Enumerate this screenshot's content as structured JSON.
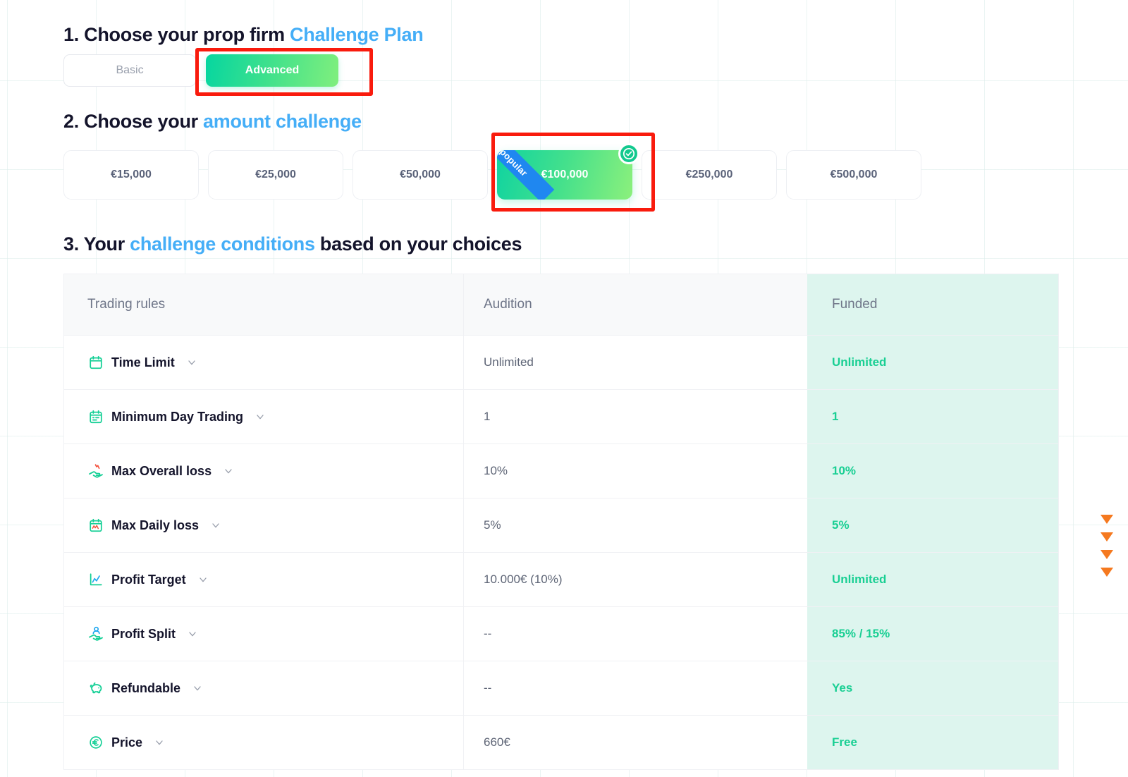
{
  "steps": {
    "step1": {
      "prefix": "1. Choose your prop firm ",
      "accent": "Challenge Plan"
    },
    "step2": {
      "prefix": "2. Choose your ",
      "accent": "amount challenge"
    },
    "step3": {
      "prefix": "3. Your ",
      "accent": "challenge conditions",
      "suffix": " based on your choices"
    }
  },
  "plan_toggle": {
    "basic_label": "Basic",
    "advanced_label": "Advanced",
    "selected": "Advanced"
  },
  "amounts": {
    "options": [
      {
        "label": "€15,000",
        "selected": false,
        "ribbon": ""
      },
      {
        "label": "€25,000",
        "selected": false,
        "ribbon": ""
      },
      {
        "label": "€50,000",
        "selected": false,
        "ribbon": ""
      },
      {
        "label": "€100,000",
        "selected": true,
        "ribbon": "popular"
      },
      {
        "label": "€250,000",
        "selected": false,
        "ribbon": ""
      },
      {
        "label": "€500,000",
        "selected": false,
        "ribbon": ""
      }
    ],
    "selected_label": "€100,000",
    "ribbon_label": "popular"
  },
  "table": {
    "headers": {
      "rules": "Trading rules",
      "audition": "Audition",
      "funded": "Funded"
    },
    "rows": [
      {
        "icon": "calendar-icon",
        "label": "Time Limit",
        "audition": "Unlimited",
        "funded": "Unlimited"
      },
      {
        "icon": "calendar-days-icon",
        "label": "Minimum Day Trading",
        "audition": "1",
        "funded": "1"
      },
      {
        "icon": "hand-loss-icon",
        "label": "Max Overall loss",
        "audition": "10%",
        "funded": "10%"
      },
      {
        "icon": "calendar-chart-icon",
        "label": "Max Daily loss",
        "audition": "5%",
        "funded": "5%"
      },
      {
        "icon": "chart-up-icon",
        "label": "Profit Target",
        "audition": "10.000€ (10%)",
        "funded": "Unlimited"
      },
      {
        "icon": "hand-user-icon",
        "label": "Profit Split",
        "audition": "--",
        "funded": "85% / 15%"
      },
      {
        "icon": "piggy-bank-icon",
        "label": "Refundable",
        "audition": "--",
        "funded": "Yes"
      },
      {
        "icon": "euro-coin-icon",
        "label": "Price",
        "audition": "660€",
        "funded": "Free"
      }
    ]
  },
  "colors": {
    "accent_blue": "#45aef7",
    "green": "#19cf93",
    "funded_bg": "#ddf5ee",
    "annotation_red": "#f91b0d",
    "ribbon_blue": "#1f87f0",
    "triangle_orange": "#f5791f"
  }
}
